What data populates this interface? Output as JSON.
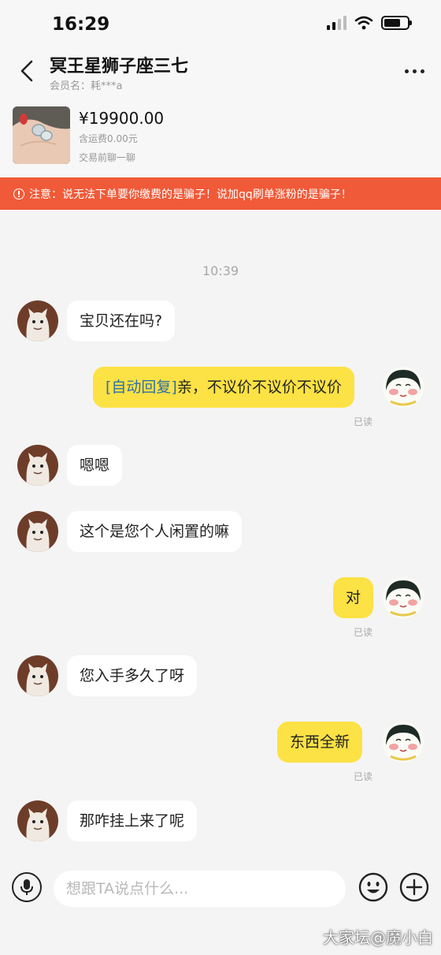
{
  "status_bar": {
    "time": "16:29"
  },
  "nav": {
    "title": "冥王星狮子座三七",
    "member_label": "会员名：耗***a"
  },
  "product": {
    "price": "¥19900.00",
    "shipping": "含运费0.00元",
    "note": "交易前聊一聊"
  },
  "warning": {
    "text": "注意：说无法下单要你缴费的是骗子！说加qq刷单涨粉的是骗子！"
  },
  "chat": {
    "timestamp": "10:39",
    "messages": [
      {
        "side": "left",
        "text": "宝贝还在吗?"
      },
      {
        "side": "right",
        "tag": "[自动回复]",
        "text": "亲，不议价不议价不议价",
        "status": "已读"
      },
      {
        "side": "left",
        "text": "嗯嗯"
      },
      {
        "side": "left",
        "text": "这个是您个人闲置的嘛"
      },
      {
        "side": "right",
        "text": "对",
        "status": "已读"
      },
      {
        "side": "left",
        "text": "您入手多久了呀"
      },
      {
        "side": "right",
        "text": "东西全新",
        "status": "已读"
      },
      {
        "side": "left",
        "text": "那咋挂上来了呢"
      }
    ]
  },
  "input_bar": {
    "placeholder": "想跟TA说点什么..."
  },
  "watermark": "大家坛@魔小白",
  "colors": {
    "accent_yellow": "#fce244",
    "warning_orange": "#f05a38",
    "auto_tag_blue": "#2e6ea8"
  }
}
